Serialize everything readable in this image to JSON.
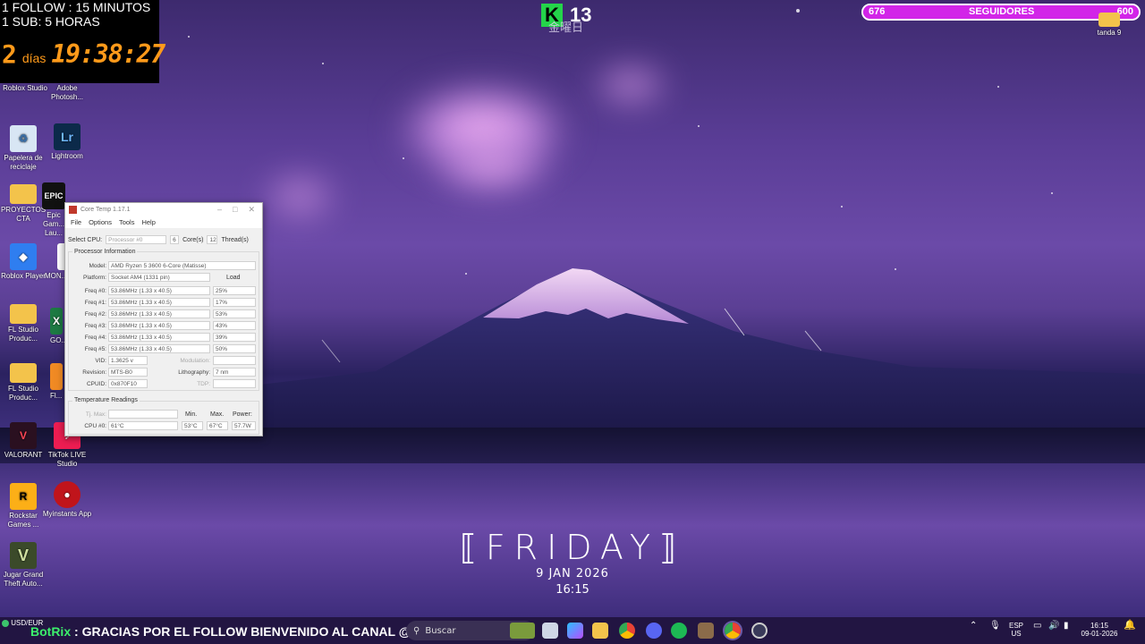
{
  "overlay": {
    "line1": "1 FOLLOW : 15 MINUTOS",
    "line2": "1 SUB: 5 HORAS",
    "days_value": "2",
    "days_label": "días",
    "clock": "19:38:27"
  },
  "top_badge": {
    "letter": "K",
    "number": "13",
    "kanji": "金曜日"
  },
  "followers_bar": {
    "current": "676",
    "label": "SEGUIDORES",
    "goal": "600",
    "fill_fraction": 1.0
  },
  "desktop_icons": {
    "roblox_studio": "Roblox Studio",
    "photoshop": "Adobe Photosh...",
    "recycle": "Papelera de reciclaje",
    "lightroom": "Lightroom",
    "lightroom_glyph": "Lr",
    "proyectos": "PROYECTOS CTA",
    "epic": "Epic Gam... Lau...",
    "epic_glyph": "EPIC",
    "roblox_player": "Roblox Player",
    "mon": "MON...",
    "fl1": "FL Studio Produc...",
    "excel": "GO...",
    "fl2": "FL Studio Produc...",
    "fl_short": "Fl...",
    "valorant": "VALORANT",
    "tiktok": "TikTok LIVE Studio",
    "rockstar": "Rockstar Games ...",
    "rockstar_glyph": "R",
    "myinstants": "Myinstants App",
    "gta": "Jugar Grand Theft Auto...",
    "gta_glyph": "V",
    "tanda": "tanda 9"
  },
  "core_temp": {
    "title": "Core Temp 1.17.1",
    "menu": [
      "File",
      "Options",
      "Tools",
      "Help"
    ],
    "select_cpu_label": "Select CPU:",
    "processor": "Processor #0",
    "cores": "6",
    "cores_label": "Core(s)",
    "threads": "12",
    "threads_label": "Thread(s)",
    "proc_info_label": "Processor Information",
    "model_label": "Model:",
    "model": "AMD Ryzen 5 3600 6-Core (Matisse)",
    "platform_label": "Platform:",
    "platform": "Socket AM4 (1331 pin)",
    "load_label": "Load",
    "freqs": [
      {
        "label": "Freq #0:",
        "value": "53.86MHz (1.33 x 40.5)",
        "load": "25%"
      },
      {
        "label": "Freq #1:",
        "value": "53.86MHz (1.33 x 40.5)",
        "load": "17%"
      },
      {
        "label": "Freq #2:",
        "value": "53.86MHz (1.33 x 40.5)",
        "load": "53%"
      },
      {
        "label": "Freq #3:",
        "value": "53.86MHz (1.33 x 40.5)",
        "load": "43%"
      },
      {
        "label": "Freq #4:",
        "value": "53.86MHz (1.33 x 40.5)",
        "load": "39%"
      },
      {
        "label": "Freq #5:",
        "value": "53.86MHz (1.33 x 40.5)",
        "load": "50%"
      }
    ],
    "vid_label": "VID:",
    "vid": "1.3625 v",
    "modulation_label": "Modulation:",
    "revision_label": "Revision:",
    "revision": "MTS-B0",
    "lithography_label": "Lithography:",
    "lithography": "7 nm",
    "cpuid_label": "CPUID:",
    "cpuid": "0x870F10",
    "tdp_label": "TDP:",
    "temp_label": "Temperature Readings",
    "tjmax_label": "Tj. Max:",
    "min_label": "Min.",
    "max_label": "Max.",
    "power_label": "Power:",
    "cpu0_label": "CPU #0:",
    "cpu0_temp": "61°C",
    "cpu0_min": "53°C",
    "cpu0_max": "67°C",
    "cpu0_power": "57.7W"
  },
  "clock_widget": {
    "day": "FRIDAY",
    "bracket_left": "⟦",
    "bracket_right": "⟧",
    "date": "9 JAN 2026",
    "time": "16:15"
  },
  "taskbar": {
    "ticker_tag": "USD/EUR",
    "ticker_bot": "BotRix",
    "ticker_text": ": GRACIAS POR EL FOLLOW BIENVENIDO AL CANAL @xkisdfp",
    "search_placeholder": "Buscar",
    "lang_top": "ESP",
    "lang_bottom": "US",
    "time": "16:15",
    "date": "09-01-2026"
  },
  "colors": {
    "accent_green": "#24d44a",
    "timer_orange": "#ff9a1a",
    "follower_bar": "#d225e8"
  }
}
